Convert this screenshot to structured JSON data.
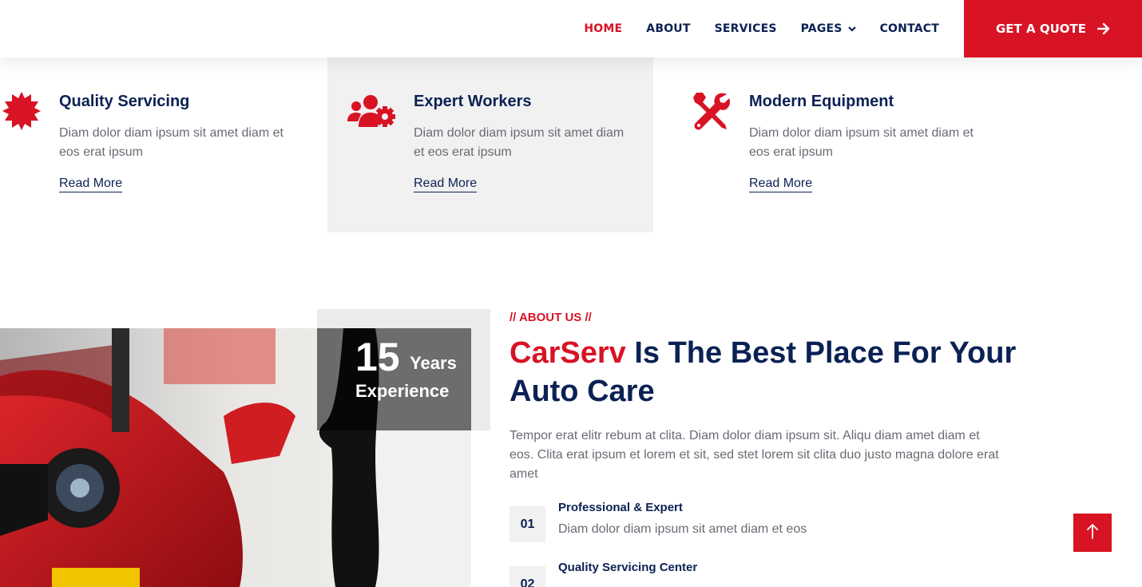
{
  "nav": {
    "items": [
      {
        "label": "HOME",
        "active": true
      },
      {
        "label": "ABOUT",
        "active": false
      },
      {
        "label": "SERVICES",
        "active": false
      },
      {
        "label": "PAGES",
        "active": false
      },
      {
        "label": "CONTACT",
        "active": false
      }
    ],
    "quote_label": "GET A QUOTE"
  },
  "features": [
    {
      "title": "Quality Servicing",
      "text": "Diam dolor diam ipsum sit amet diam et eos erat ipsum",
      "link": "Read More",
      "icon": "certificate-icon"
    },
    {
      "title": "Expert Workers",
      "text": "Diam dolor diam ipsum sit amet diam et eos erat ipsum",
      "link": "Read More",
      "icon": "users-cog-icon"
    },
    {
      "title": "Modern Equipment",
      "text": "Diam dolor diam ipsum sit amet diam et eos erat ipsum",
      "link": "Read More",
      "icon": "tools-icon"
    }
  ],
  "about": {
    "tag": "// ABOUT US //",
    "title_brand": "CarServ",
    "title_rest": " Is The Best Place For Your Auto Care",
    "description": "Tempor erat elitr rebum at clita. Diam dolor diam ipsum sit. Aliqu diam amet diam et eos. Clita erat ipsum et lorem et sit, sed stet lorem sit clita duo justo magna dolore erat amet",
    "experience_number": "15",
    "experience_years": "Years",
    "experience_label": "Experience",
    "items": [
      {
        "num": "01",
        "title": "Professional & Expert",
        "text": "Diam dolor diam ipsum sit amet diam et eos"
      },
      {
        "num": "02",
        "title": "Quality Servicing Center",
        "text": ""
      }
    ]
  },
  "colors": {
    "primary": "#D81324",
    "dark": "#0B2154",
    "light": "#F1F1F1",
    "body": "#6B6A75"
  }
}
